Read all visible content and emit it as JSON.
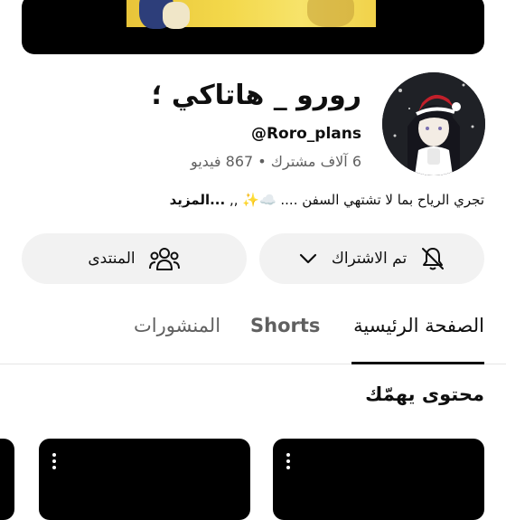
{
  "channel": {
    "name": "رورو _ هاتاكي ؛",
    "handle": "@Roro_plans",
    "stats": "6 آلاف مشترك • 867 فيديو",
    "description": "تجري الرياح بما لا تشتهي السفن .... ☁️✨ ,, ",
    "more_label": "...المزيد"
  },
  "buttons": {
    "subscribed_label": "تم الاشتراك",
    "community_label": "المنتدى"
  },
  "tabs": [
    {
      "label": "الصفحة الرئيسية",
      "selected": true
    },
    {
      "label": "Shorts",
      "selected": false
    },
    {
      "label": "المنشورات",
      "selected": false
    }
  ],
  "section": {
    "title": "محتوى يهمّك"
  },
  "icons": {
    "subscribe": "bell-off-icon",
    "dropdown": "chevron-down-icon",
    "community": "people-icon",
    "card_menu": "more-vertical-icon"
  }
}
